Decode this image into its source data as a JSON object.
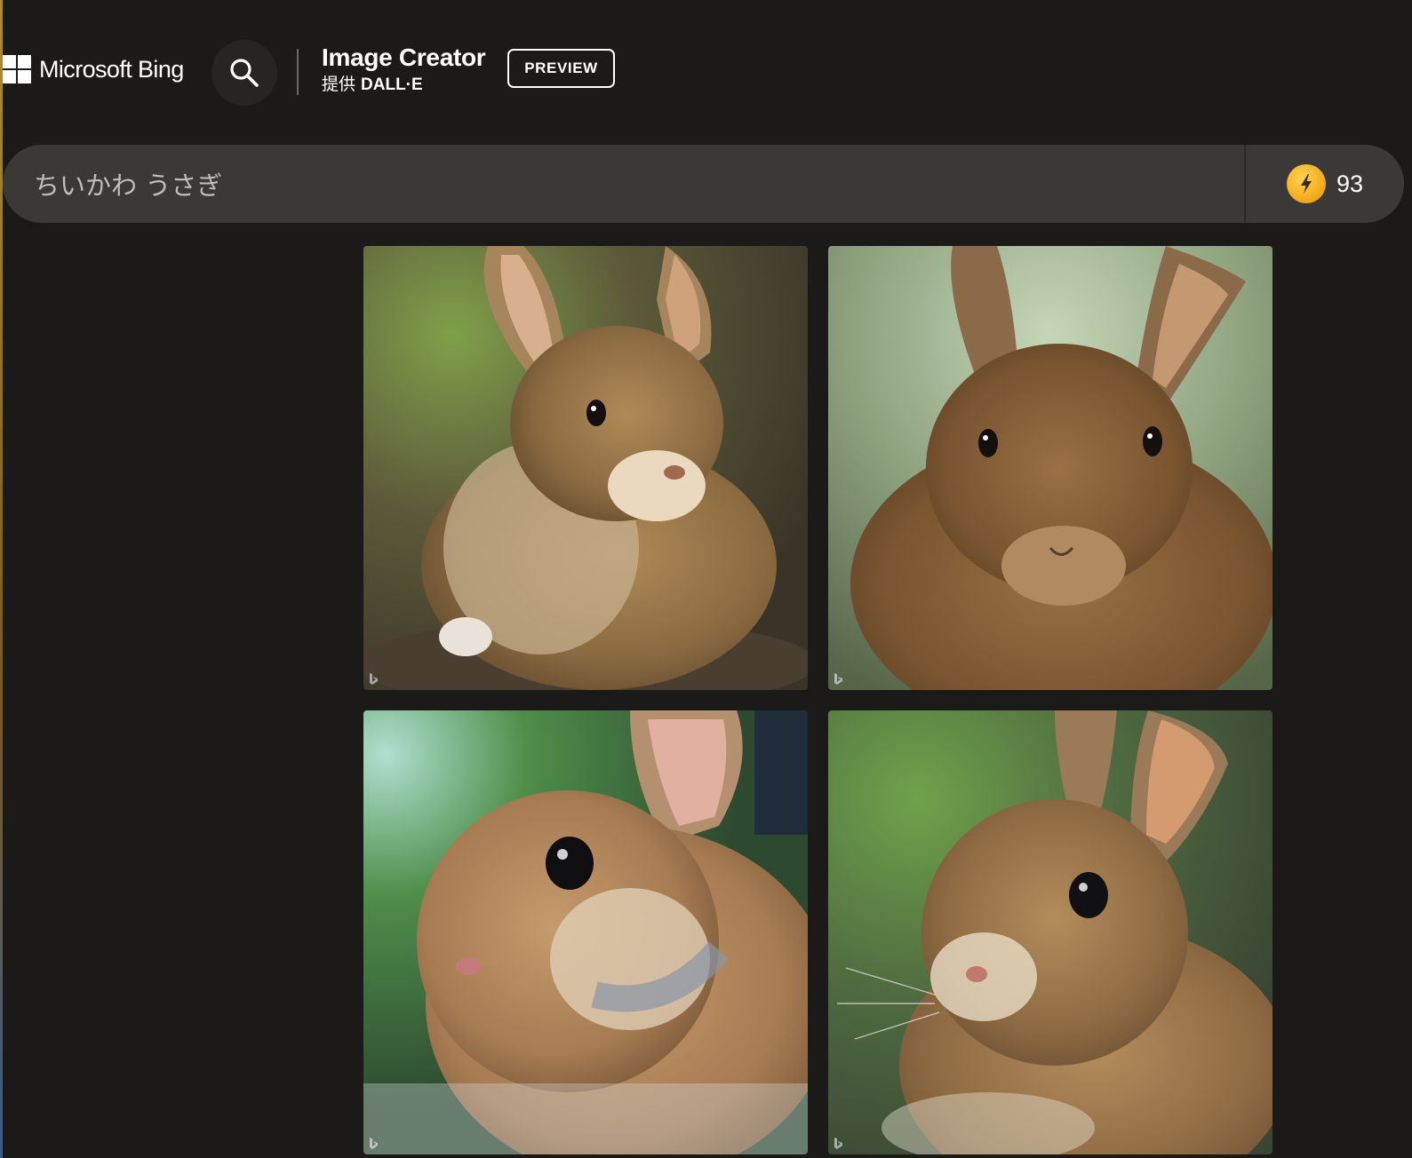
{
  "header": {
    "brand_name": "Microsoft Bing",
    "product_title": "Image Creator",
    "product_by": "提供",
    "product_engine": "DALL·E",
    "preview_label": "PREVIEW"
  },
  "prompt": {
    "value": "ちいかわ うさぎ"
  },
  "boosts": {
    "count": "93",
    "icon": "lightning-bolt-icon",
    "color": "#f2a818"
  },
  "results": {
    "images": [
      {
        "subject": "brown bunny"
      },
      {
        "subject": "brown bunny"
      },
      {
        "subject": "brown bunny"
      },
      {
        "subject": "brown bunny"
      }
    ]
  },
  "colors": {
    "background": "#1b1a19",
    "prompt_bar": "#3a3938",
    "search_button": "#262524",
    "text": "#ffffff",
    "prompt_text": "#bdbdbd"
  }
}
